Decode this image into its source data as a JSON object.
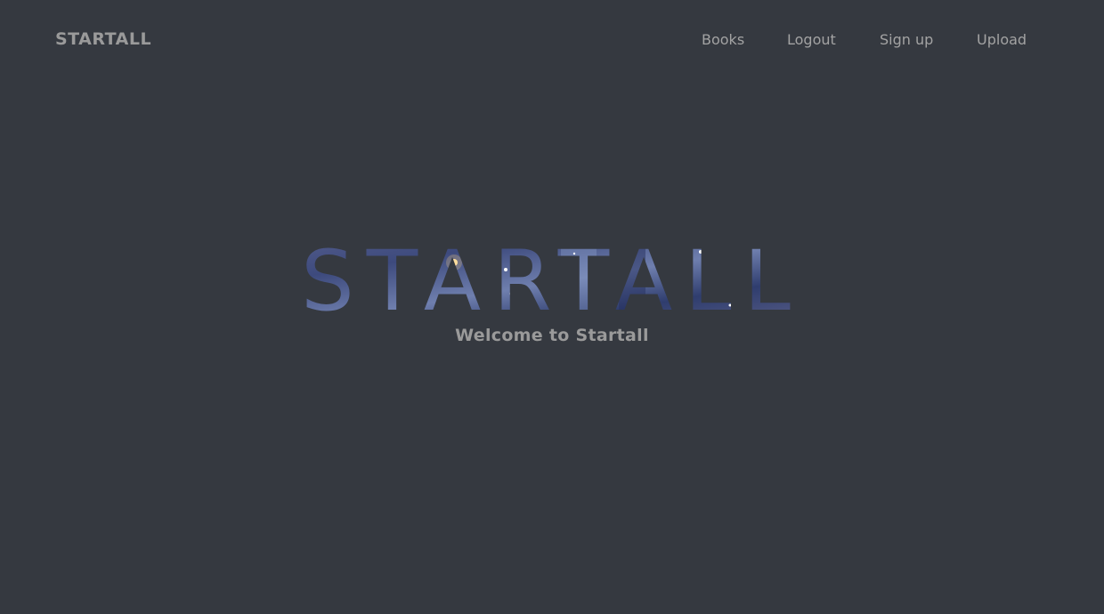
{
  "nav": {
    "brand": "STARTALL",
    "links": [
      {
        "label": "Books"
      },
      {
        "label": "Logout"
      },
      {
        "label": "Sign up"
      },
      {
        "label": "Upload"
      }
    ]
  },
  "hero": {
    "title": "STARTALL",
    "subtitle": "Welcome to Startall"
  },
  "colors": {
    "background": "#353940",
    "nav_text": "#a3a3a3",
    "brand_text": "#9a9a9a",
    "subtitle_text": "#9a9a9a",
    "title_fill_base": "#3d4a78"
  }
}
